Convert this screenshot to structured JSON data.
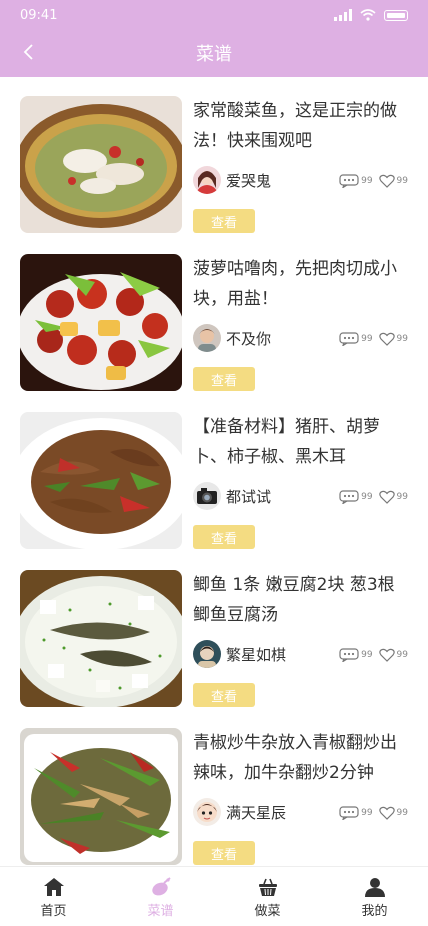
{
  "status": {
    "time": "09:41"
  },
  "header": {
    "title": "菜谱",
    "back_icon": "chevron-left-icon"
  },
  "colors": {
    "accent": "#deb0e3",
    "button": "#f4dc82"
  },
  "recipes": [
    {
      "title": "家常酸菜鱼，这是正宗的做法！快来围观吧",
      "author": "爱哭鬼",
      "comments": "99",
      "likes": "99",
      "button": "查看"
    },
    {
      "title": "菠萝咕噜肉，先把肉切成小块，用盐！",
      "author": "不及你",
      "comments": "99",
      "likes": "99",
      "button": "查看"
    },
    {
      "title": "【准备材料】猪肝、胡萝卜、柿子椒、黑木耳",
      "author": "都试试",
      "comments": "99",
      "likes": "99",
      "button": "查看"
    },
    {
      "title": "鲫鱼 1条 嫩豆腐2块 葱3根 鲫鱼豆腐汤",
      "author": "繁星如棋",
      "comments": "99",
      "likes": "99",
      "button": "查看"
    },
    {
      "title": "青椒炒牛杂放入青椒翻炒出辣味，加牛杂翻炒2分钟",
      "author": "满天星辰",
      "comments": "99",
      "likes": "99",
      "button": "查看"
    }
  ],
  "tabbar": [
    {
      "label": "首页",
      "icon": "home-icon"
    },
    {
      "label": "菜谱",
      "icon": "recipe-icon",
      "active": true
    },
    {
      "label": "做菜",
      "icon": "basket-icon"
    },
    {
      "label": "我的",
      "icon": "user-icon"
    }
  ]
}
